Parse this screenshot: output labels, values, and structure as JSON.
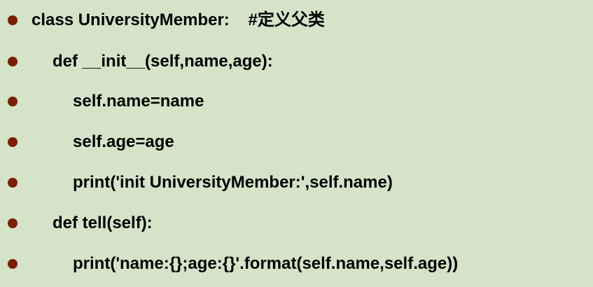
{
  "colors": {
    "background": "#d5e3c8",
    "bullet": "#7a1e06",
    "text": "#000000"
  },
  "code_lines": [
    {
      "text": "class UniversityMember:    #定义父类",
      "indent": 0
    },
    {
      "text": "def __init__(self,name,age):",
      "indent": 1
    },
    {
      "text": "self.name=name",
      "indent": 2
    },
    {
      "text": "self.age=age",
      "indent": 2
    },
    {
      "text": "print('init UniversityMember:',self.name)",
      "indent": 2
    },
    {
      "text": "def tell(self):",
      "indent": 1
    },
    {
      "text": "print('name:{};age:{}'.format(self.name,self.age))",
      "indent": 2
    }
  ]
}
